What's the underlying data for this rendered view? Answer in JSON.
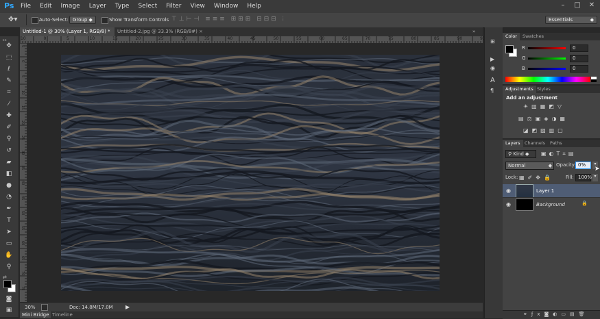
{
  "app": {
    "logo": "Ps"
  },
  "menu": [
    "File",
    "Edit",
    "Image",
    "Layer",
    "Type",
    "Select",
    "Filter",
    "View",
    "Window",
    "Help"
  ],
  "window_controls": {
    "minimize": "–",
    "maximize": "□",
    "close": "✕"
  },
  "options": {
    "auto_select_label": "Auto-Select:",
    "auto_select_value": "Group",
    "show_transform_label": "Show Transform Controls",
    "workspace": "Essentials"
  },
  "doc_tabs": [
    {
      "label": "Untitled-1 @ 30% (Layer 1, RGB/8) *",
      "active": true
    },
    {
      "label": "Untitled-2.jpg @ 33.3% (RGB/8#)",
      "active": false
    }
  ],
  "ruler_top": [
    "10",
    "0",
    "5",
    "10",
    "15",
    "20",
    "25",
    "30",
    "35",
    "40",
    "45",
    "50",
    "55",
    "60",
    "65",
    "70",
    "75",
    "80",
    "85",
    "90",
    "95",
    "100"
  ],
  "ruler_left": [
    "5",
    "0",
    "5",
    "10",
    "15",
    "20",
    "25",
    "30",
    "35",
    "40",
    "45",
    "50",
    "55",
    "60",
    "65",
    "70",
    "75"
  ],
  "status": {
    "zoom": "30%",
    "doc": "Doc: 14.8M/17.0M"
  },
  "bottom_tabs": [
    "Mini Bridge",
    "Timeline"
  ],
  "color_panel": {
    "tabs": [
      "Color",
      "Swatches"
    ],
    "channels": [
      {
        "label": "R",
        "value": "0",
        "color": "#ff0000"
      },
      {
        "label": "G",
        "value": "0",
        "color": "#00c000"
      },
      {
        "label": "B",
        "value": "0",
        "color": "#0000ff"
      }
    ]
  },
  "adjustments_panel": {
    "tabs": [
      "Adjustments",
      "Styles"
    ],
    "title": "Add an adjustment"
  },
  "layers_panel": {
    "tabs": [
      "Layers",
      "Channels",
      "Paths"
    ],
    "kind": "Kind",
    "blend_mode": "Normal",
    "opacity_label": "Opacity:",
    "opacity_value": "0%",
    "lock_label": "Lock:",
    "fill_label": "Fill:",
    "fill_value": "100%",
    "layers": [
      {
        "name": "Layer 1",
        "selected": true
      },
      {
        "name": "Background",
        "selected": false
      }
    ]
  },
  "colors": {
    "accent": "#31a8ff",
    "selected_layer": "#4f5d75"
  }
}
